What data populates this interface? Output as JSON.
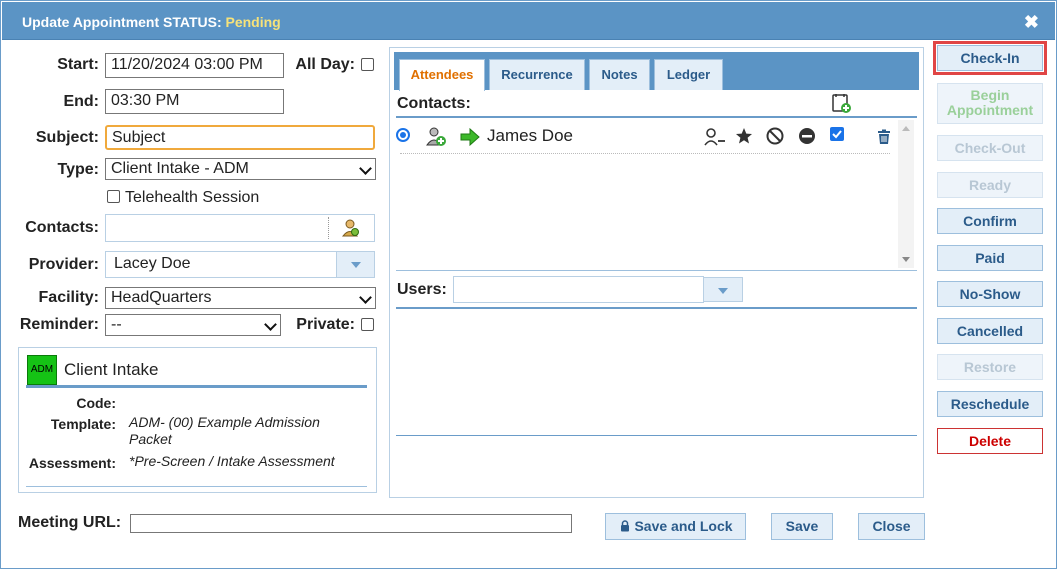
{
  "title": {
    "prefix": "Update Appointment STATUS:",
    "status": "Pending"
  },
  "form": {
    "start_label": "Start:",
    "start_value": "11/20/2024 03:00 PM",
    "allday_label": "All Day:",
    "end_label": "End:",
    "end_value": "03:30 PM",
    "subject_label": "Subject:",
    "subject_value": "Subject",
    "type_label": "Type:",
    "type_value": "Client Intake - ADM",
    "telehealth_label": "Telehealth Session",
    "contacts_label": "Contacts:",
    "provider_label": "Provider:",
    "provider_value": "Lacey Doe",
    "facility_label": "Facility:",
    "facility_value": "HeadQuarters",
    "reminder_label": "Reminder:",
    "reminder_value": "--",
    "private_label": "Private:",
    "meeting_label": "Meeting URL:"
  },
  "card": {
    "badge": "ADM",
    "name": "Client Intake",
    "code_label": "Code:",
    "template_label": "Template:",
    "template_value": "ADM- (00) Example Admission Packet",
    "assessment_label": "Assessment:",
    "assessment_value": "*Pre-Screen / Intake Assessment"
  },
  "tabs": [
    "Attendees",
    "Recurrence",
    "Notes",
    "Ledger"
  ],
  "attendees": {
    "contacts_title": "Contacts:",
    "users_title": "Users:",
    "contact_name": "James Doe"
  },
  "footer": {
    "save_lock": "Save and Lock",
    "save": "Save",
    "close": "Close"
  },
  "actions": [
    "Check-In",
    "Begin Appointment",
    "Check-Out",
    "Ready",
    "Confirm",
    "Paid",
    "No-Show",
    "Cancelled",
    "Restore",
    "Reschedule",
    "Delete"
  ],
  "colors": {
    "accent": "#5b94c5",
    "status": "#f6e27a",
    "adm_badge": "#15c215",
    "delete": "#cc0000"
  }
}
